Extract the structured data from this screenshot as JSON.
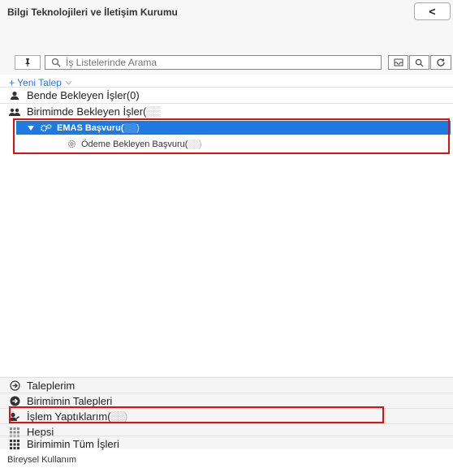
{
  "header": {
    "org_title": "Bilgi Teknolojileri ve İletişim Kurumu",
    "collapse_label": "<",
    "user_name": "",
    "user_role": ""
  },
  "search": {
    "placeholder": "İş Listelerinde Arama"
  },
  "new_request": {
    "label": "+ Yeni Talep",
    "icon": "chevron-down-icon"
  },
  "nav_top": [
    {
      "label": "Bende Bekleyen İşler(0)",
      "icon": "user-icon"
    },
    {
      "label": "Birimimde Bekleyen İşler(",
      "icon": "users-icon"
    }
  ],
  "tree": {
    "selected_label": "EMAS Başvuru(",
    "child_label": "Ödeme Bekleyen Başvuru("
  },
  "nav_bottom": [
    {
      "label": "Taleplerim",
      "icon": "arrow-circle-right-icon"
    },
    {
      "label": "Birimimin Talepleri",
      "icon": "arrow-circle-filled-icon"
    },
    {
      "label": "İşlem Yaptıklarım(",
      "icon": "user-edit-icon"
    },
    {
      "label": "Hepsi",
      "icon": "grid-icon"
    },
    {
      "label": "Birimimin Tüm İşleri",
      "icon": "grid-icon"
    }
  ],
  "footer": {
    "label": "Bireysel Kullanım"
  },
  "colors": {
    "accent": "#1e7ae0",
    "highlight": "#e01010",
    "link": "#2a7ae2"
  }
}
